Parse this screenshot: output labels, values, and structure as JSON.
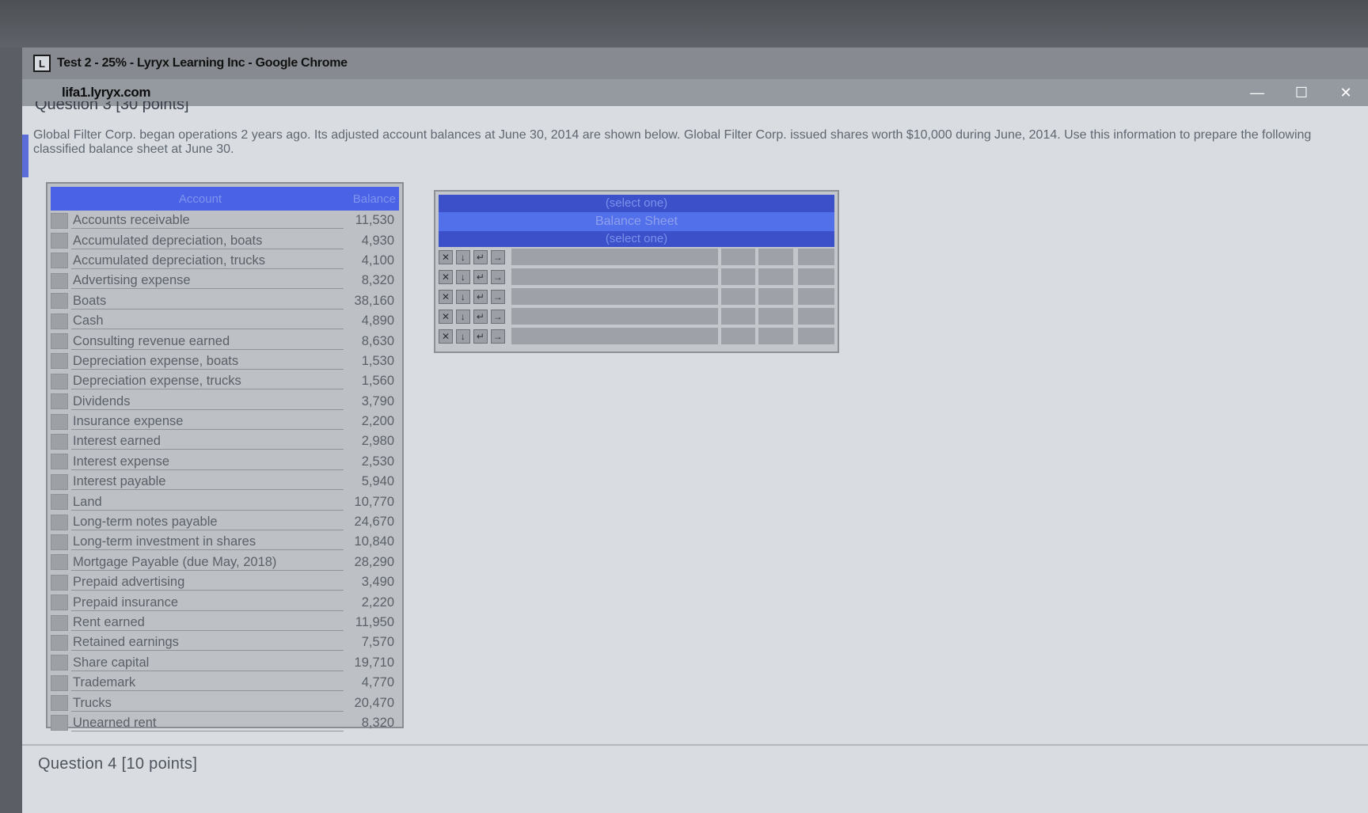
{
  "browser": {
    "window_title": "Test 2 - 25% - Lyryx Learning Inc - Google Chrome",
    "app_icon_glyph": "L",
    "url": "lifa1.lyryx.com",
    "controls": {
      "minimize": "—",
      "maximize": "☐",
      "close": "✕"
    }
  },
  "page": {
    "cut_header": "Question 3 [30 points]",
    "instructions": "Global Filter Corp. began operations 2 years ago. Its adjusted account balances at June 30, 2014 are shown below. Global Filter Corp. issued shares worth $10,000 during June, 2014. Use this information to prepare the following classified balance sheet at June 30.",
    "accounts": {
      "header_account": "Account",
      "header_balance": "Balance",
      "rows": [
        {
          "name": "Accounts receivable",
          "balance": "11,530"
        },
        {
          "name": "Accumulated depreciation, boats",
          "balance": "4,930"
        },
        {
          "name": "Accumulated depreciation, trucks",
          "balance": "4,100"
        },
        {
          "name": "Advertising expense",
          "balance": "8,320"
        },
        {
          "name": "Boats",
          "balance": "38,160"
        },
        {
          "name": "Cash",
          "balance": "4,890"
        },
        {
          "name": "Consulting revenue earned",
          "balance": "8,630"
        },
        {
          "name": "Depreciation expense, boats",
          "balance": "1,530"
        },
        {
          "name": "Depreciation expense, trucks",
          "balance": "1,560"
        },
        {
          "name": "Dividends",
          "balance": "3,790"
        },
        {
          "name": "Insurance expense",
          "balance": "2,200"
        },
        {
          "name": "Interest earned",
          "balance": "2,980"
        },
        {
          "name": "Interest expense",
          "balance": "2,530"
        },
        {
          "name": "Interest payable",
          "balance": "5,940"
        },
        {
          "name": "Land",
          "balance": "10,770"
        },
        {
          "name": "Long-term notes payable",
          "balance": "24,670"
        },
        {
          "name": "Long-term investment in shares",
          "balance": "10,840"
        },
        {
          "name": "Mortgage Payable (due May, 2018)",
          "balance": "28,290"
        },
        {
          "name": "Prepaid advertising",
          "balance": "3,490"
        },
        {
          "name": "Prepaid insurance",
          "balance": "2,220"
        },
        {
          "name": "Rent earned",
          "balance": "11,950"
        },
        {
          "name": "Retained earnings",
          "balance": "7,570"
        },
        {
          "name": "Share capital",
          "balance": "19,710"
        },
        {
          "name": "Trademark",
          "balance": "4,770"
        },
        {
          "name": "Trucks",
          "balance": "20,470"
        },
        {
          "name": "Unearned rent",
          "balance": "8,320"
        }
      ]
    },
    "balance_sheet": {
      "company_select": "(select one)",
      "title": "Balance Sheet",
      "date_select": "(select one)",
      "row_controls": [
        "✕",
        "↓",
        "↵",
        "→"
      ],
      "row_count": 5
    },
    "next_question": "Question 4 [10 points]"
  }
}
